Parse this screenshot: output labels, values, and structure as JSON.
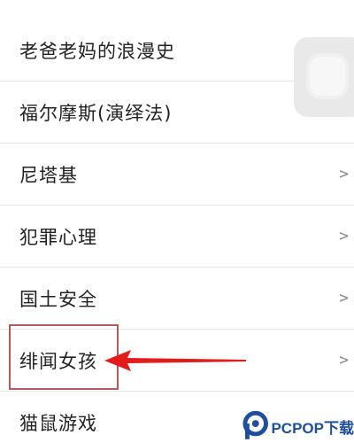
{
  "list": {
    "items": [
      {
        "label": "老爸老妈的浪漫史",
        "chevron": ">"
      },
      {
        "label": "福尔摩斯(演绎法)",
        "chevron": ">"
      },
      {
        "label": "尼塔基",
        "chevron": ">"
      },
      {
        "label": "犯罪心理",
        "chevron": ">"
      },
      {
        "label": "国土安全",
        "chevron": ">"
      },
      {
        "label": "绯闻女孩",
        "chevron": ">"
      },
      {
        "label": "猫鼠游戏",
        "chevron": ""
      }
    ]
  },
  "annotation": {
    "highlight_color": "#b55a5a",
    "arrow_color": "#e21b1b"
  },
  "watermark": {
    "text": "PCPOP下载",
    "color": "#1f4e9c"
  }
}
